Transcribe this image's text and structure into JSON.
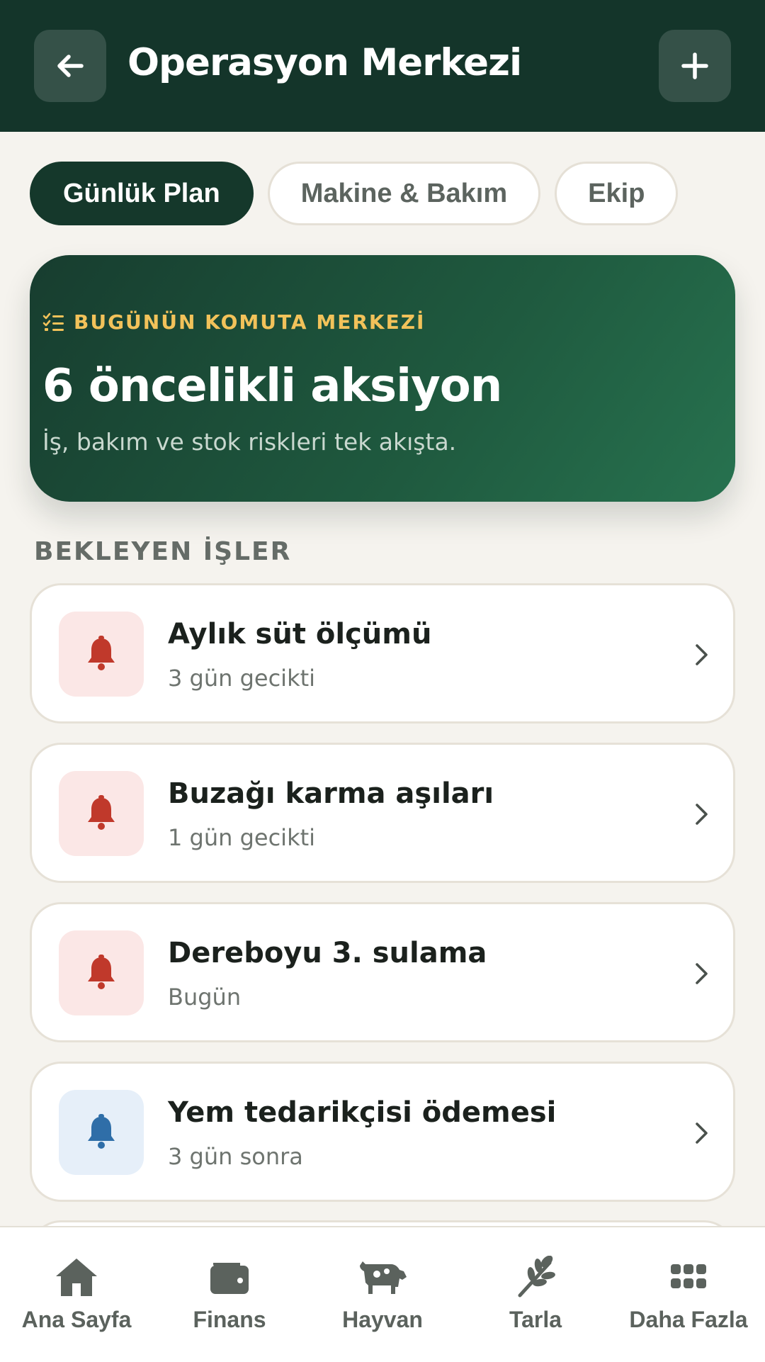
{
  "header": {
    "title": "Operasyon Merkezi",
    "back_icon": "arrow-left-icon",
    "add_icon": "plus-icon"
  },
  "tabs": [
    {
      "label": "Günlük Plan",
      "active": true
    },
    {
      "label": "Makine & Bakım",
      "active": false
    },
    {
      "label": "Ekip",
      "active": false
    }
  ],
  "hero": {
    "kicker": "BUGÜNÜN KOMUTA MERKEZİ",
    "kicker_icon": "checklist-icon",
    "title": "6 öncelikli aksiyon",
    "subtitle": "İş, bakım ve stok riskleri tek akışta."
  },
  "section": {
    "title": "BEKLEYEN İŞLER"
  },
  "tasks": [
    {
      "title": "Aylık süt ölçümü",
      "subtitle": "3 gün gecikti",
      "icon": "bell-icon",
      "tone": "red"
    },
    {
      "title": "Buzağı karma aşıları",
      "subtitle": "1 gün gecikti",
      "icon": "bell-icon",
      "tone": "red"
    },
    {
      "title": "Dereboyu 3. sulama",
      "subtitle": "Bugün",
      "icon": "bell-icon",
      "tone": "red"
    },
    {
      "title": "Yem tedarikçisi ödemesi",
      "subtitle": "3 gün sonra",
      "icon": "bell-icon",
      "tone": "blue"
    }
  ],
  "nav": [
    {
      "label": "Ana Sayfa",
      "icon": "home-icon"
    },
    {
      "label": "Finans",
      "icon": "wallet-icon"
    },
    {
      "label": "Hayvan",
      "icon": "cow-icon"
    },
    {
      "label": "Tarla",
      "icon": "wheat-icon"
    },
    {
      "label": "Daha Fazla",
      "icon": "grid-icon"
    }
  ],
  "colors": {
    "header_bg": "#14352a",
    "accent_gold": "#f2c25a",
    "alert_red": "#c0392b",
    "info_blue": "#2f6ea8",
    "background": "#f5f3ee"
  }
}
